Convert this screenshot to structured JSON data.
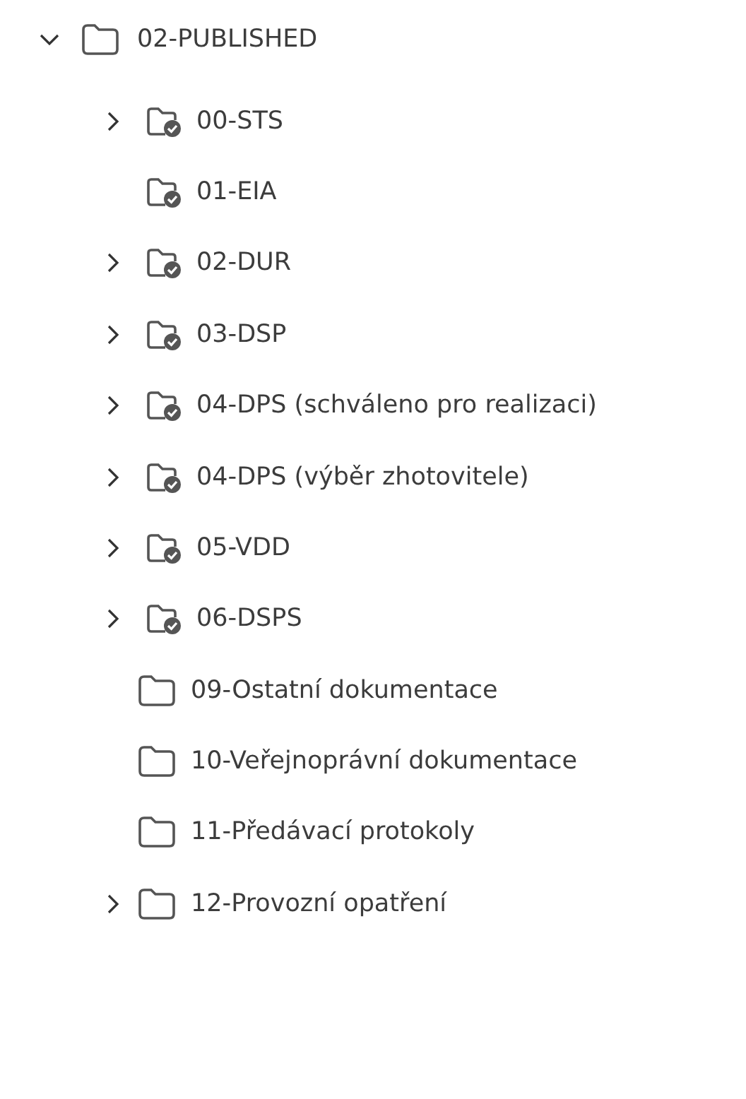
{
  "tree": {
    "label": "02-PUBLISHED",
    "kind": "plain",
    "expandable": true,
    "expanded": true,
    "children": [
      {
        "label": "00-STS",
        "kind": "published",
        "expandable": true,
        "expanded": false
      },
      {
        "label": "01-EIA",
        "kind": "published",
        "expandable": false
      },
      {
        "label": "02-DUR",
        "kind": "published",
        "expandable": true,
        "expanded": false
      },
      {
        "label": "03-DSP",
        "kind": "published",
        "expandable": true,
        "expanded": false
      },
      {
        "label": "04-DPS (schváleno pro realizaci)",
        "kind": "published",
        "expandable": true,
        "expanded": false
      },
      {
        "label": "04-DPS (výběr zhotovitele)",
        "kind": "published",
        "expandable": true,
        "expanded": false
      },
      {
        "label": "05-VDD",
        "kind": "published",
        "expandable": true,
        "expanded": false
      },
      {
        "label": "06-DSPS",
        "kind": "published",
        "expandable": true,
        "expanded": false
      },
      {
        "label": "09-Ostatní dokumentace",
        "kind": "plain",
        "expandable": false
      },
      {
        "label": "10-Veřejnoprávní dokumentace",
        "kind": "plain",
        "expandable": false
      },
      {
        "label": "11-Předávací protokoly",
        "kind": "plain",
        "expandable": false
      },
      {
        "label": "12-Provozní opatření",
        "kind": "plain",
        "expandable": true,
        "expanded": false
      }
    ]
  }
}
